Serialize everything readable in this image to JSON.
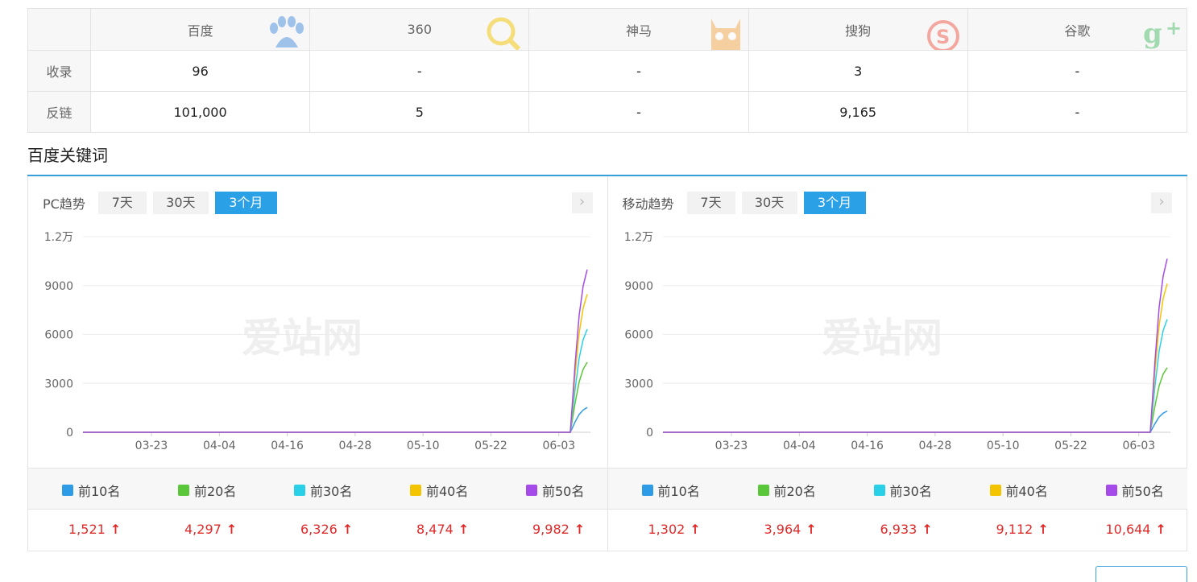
{
  "engines": {
    "columns": [
      "百度",
      "360",
      "神马",
      "搜狗",
      "谷歌"
    ],
    "rows": [
      {
        "label": "收录",
        "values": [
          "96",
          "-",
          "-",
          "3",
          "-"
        ]
      },
      {
        "label": "反链",
        "values": [
          "101,000",
          "5",
          "-",
          "9,165",
          "-"
        ]
      }
    ],
    "logo_icons": [
      "baidu-paw-icon",
      "360-magnifier-icon",
      "shenma-alpaca-icon",
      "sogou-s-icon",
      "google-plus-icon"
    ]
  },
  "section_title": "百度关键词",
  "tabs": [
    "7天",
    "30天",
    "3个月"
  ],
  "active_tab": "3个月",
  "watermark": "爱站网",
  "colors": {
    "accent": "#2aa0e6",
    "up_arrow": "#e02a2a"
  },
  "panels": [
    {
      "title": "PC趋势",
      "legend": [
        "前10名",
        "前20名",
        "前30名",
        "前40名",
        "前50名"
      ],
      "values": [
        "1,521",
        "4,297",
        "6,326",
        "8,474",
        "9,982"
      ]
    },
    {
      "title": "移动趋势",
      "legend": [
        "前10名",
        "前20名",
        "前30名",
        "前40名",
        "前50名"
      ],
      "values": [
        "1,302",
        "3,964",
        "6,933",
        "9,112",
        "10,644"
      ]
    }
  ],
  "chart_data": [
    {
      "type": "line",
      "title": "PC趋势",
      "x_ticks": [
        "03-23",
        "04-04",
        "04-16",
        "04-28",
        "05-10",
        "05-22",
        "06-03"
      ],
      "y_ticks": [
        "0",
        "3000",
        "6000",
        "9000",
        "1.2万"
      ],
      "ylim": [
        0,
        12000
      ],
      "grid": true,
      "series": [
        {
          "name": "前10名",
          "color": "#2e9be6",
          "final": 1521
        },
        {
          "name": "前20名",
          "color": "#5ac73a",
          "final": 4297
        },
        {
          "name": "前30名",
          "color": "#29d0e8",
          "final": 6326
        },
        {
          "name": "前40名",
          "color": "#f5c400",
          "final": 8474
        },
        {
          "name": "前50名",
          "color": "#a44bea",
          "final": 9982
        }
      ]
    },
    {
      "type": "line",
      "title": "移动趋势",
      "x_ticks": [
        "03-23",
        "04-04",
        "04-16",
        "04-28",
        "05-10",
        "05-22",
        "06-03"
      ],
      "y_ticks": [
        "0",
        "3000",
        "6000",
        "9000",
        "1.2万"
      ],
      "ylim": [
        0,
        12000
      ],
      "grid": true,
      "series": [
        {
          "name": "前10名",
          "color": "#2e9be6",
          "final": 1302
        },
        {
          "name": "前20名",
          "color": "#5ac73a",
          "final": 3964
        },
        {
          "name": "前30名",
          "color": "#29d0e8",
          "final": 6933
        },
        {
          "name": "前40名",
          "color": "#f5c400",
          "final": 9112
        },
        {
          "name": "前50名",
          "color": "#a44bea",
          "final": 10644
        }
      ]
    }
  ]
}
